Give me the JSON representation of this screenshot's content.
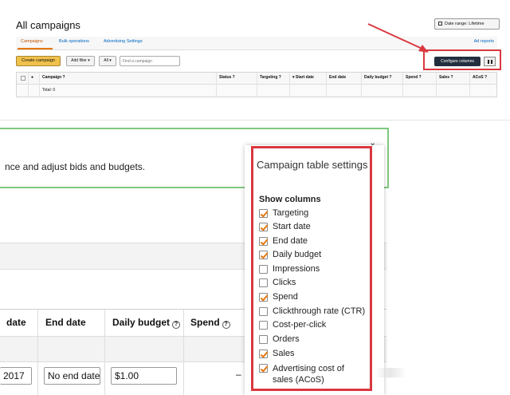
{
  "header": {
    "title": "All campaigns",
    "date_range": "Date range: Lifetime"
  },
  "tabs": [
    "Campaigns",
    "Bulk operations",
    "Advertising Settings"
  ],
  "ad_reports": "Ad reports",
  "toolbar": {
    "create": "Create campaign",
    "add_filter": "Add filter",
    "all": "All",
    "find_placeholder": "Find a campaign",
    "configure": "Configure columns"
  },
  "top_table": {
    "columns": [
      "Campaign",
      "Status",
      "Targeting",
      "Start date",
      "End date",
      "Daily budget",
      "Spend",
      "Sales",
      "ACoS"
    ],
    "total": "Total: 0"
  },
  "banner": {
    "text": "nce and adjust bids and budgets."
  },
  "grid": {
    "columns": [
      "date",
      "End date",
      "Daily budget",
      "Spend"
    ],
    "row": [
      "2017",
      "No end date",
      "$1.00",
      "–"
    ]
  },
  "panel": {
    "title": "Campaign table settings",
    "show_columns": "Show columns",
    "options": [
      {
        "label": "Targeting",
        "checked": true
      },
      {
        "label": "Start date",
        "checked": true
      },
      {
        "label": "End date",
        "checked": true
      },
      {
        "label": "Daily budget",
        "checked": true
      },
      {
        "label": "Impressions",
        "checked": false
      },
      {
        "label": "Clicks",
        "checked": false
      },
      {
        "label": "Spend",
        "checked": true
      },
      {
        "label": "Clickthrough rate (CTR)",
        "checked": false
      },
      {
        "label": "Cost-per-click",
        "checked": false
      },
      {
        "label": "Orders",
        "checked": false
      },
      {
        "label": "Sales",
        "checked": true
      },
      {
        "label": "Advertising cost of sales (ACoS)",
        "checked": true
      }
    ]
  },
  "colors": {
    "accent_orange": "#e47911",
    "highlight_red": "#d9383f",
    "banner_green": "#7fc87f",
    "dark_button": "#232f3e"
  }
}
